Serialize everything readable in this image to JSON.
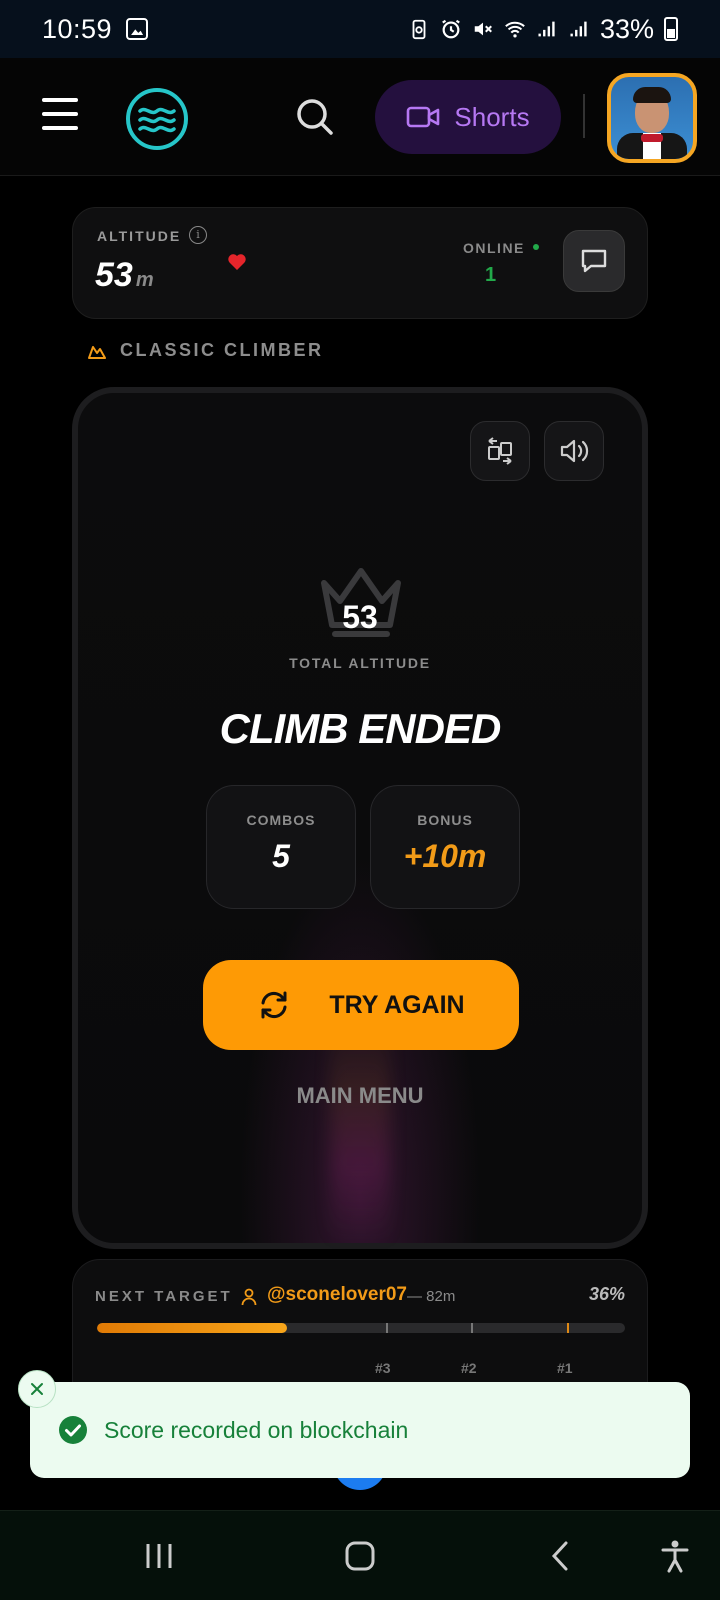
{
  "status_bar": {
    "time": "10:59",
    "battery": "33%"
  },
  "header": {
    "shorts_label": "Shorts",
    "icons": [
      "menu-icon",
      "logo-icon",
      "search-icon",
      "video-icon",
      "avatar"
    ]
  },
  "altitude_card": {
    "label": "ALTITUDE",
    "value": "53",
    "unit": "m",
    "online_label": "ONLINE",
    "online_count": "1"
  },
  "mode": {
    "label": "CLASSIC CLIMBER"
  },
  "result": {
    "total_altitude": "53",
    "total_label": "TOTAL ALTITUDE",
    "title": "CLIMB ENDED",
    "combos_label": "COMBOS",
    "combos_value": "5",
    "bonus_label": "BONUS",
    "bonus_value": "+10m",
    "try_again_label": "TRY AGAIN",
    "main_menu_label": "MAIN MENU"
  },
  "next_target": {
    "label": "NEXT TARGET",
    "user": "@sconelover07",
    "distance": "— 82m",
    "percent": "36%",
    "progress": 0.36,
    "ranks": [
      "#3",
      "#2",
      "#1"
    ]
  },
  "toast": {
    "message": "Score recorded on blockchain"
  },
  "colors": {
    "accent_orange": "#fe9a05",
    "online_green": "#22a94a",
    "shorts_purple": "#b678f3",
    "toast_green": "#17813a"
  }
}
